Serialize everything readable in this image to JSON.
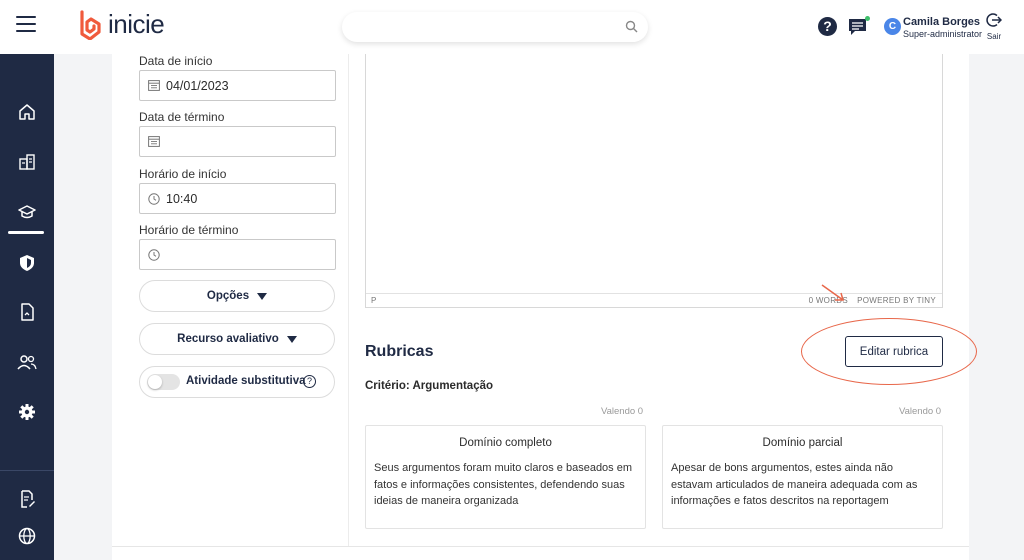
{
  "brand": {
    "name": "inicie",
    "color": "#f05a3c"
  },
  "header": {
    "search_placeholder": "",
    "user_initial": "C",
    "user_name": "Camila Borges",
    "user_role": "Super-administrator",
    "logout_label": "Sair"
  },
  "sidebar": {
    "items": [
      {
        "icon": "home-icon"
      },
      {
        "icon": "buildings-icon"
      },
      {
        "icon": "graduation-cap-icon",
        "active": true
      },
      {
        "icon": "shield-icon"
      },
      {
        "icon": "document-icon"
      },
      {
        "icon": "users-icon"
      },
      {
        "icon": "gear-icon"
      },
      {
        "icon": "document-edit-icon"
      },
      {
        "icon": "globe-icon"
      }
    ]
  },
  "form": {
    "start_date_label": "Data de início",
    "start_date_value": "04/01/2023",
    "end_date_label": "Data de término",
    "end_date_value": "",
    "start_time_label": "Horário de início",
    "start_time_value": "10:40",
    "end_time_label": "Horário de término",
    "end_time_value": "",
    "options_label": "Opções",
    "resource_label": "Recurso avaliativo",
    "substitute_label": "Atividade substitutiva",
    "substitute_on": false
  },
  "editor": {
    "path": "P",
    "word_count": "0 WORDS",
    "powered_by": "POWERED BY TINY"
  },
  "rubricas": {
    "title": "Rubricas",
    "edit_button": "Editar rubrica",
    "criterion": "Critério: Argumentação",
    "levels": [
      {
        "worth": "Valendo 0",
        "title": "Domínio completo",
        "description": "Seus argumentos foram muito claros e baseados em fatos e informações consistentes, defendendo suas ideias de maneira organizada"
      },
      {
        "worth": "Valendo 0",
        "title": "Domínio parcial",
        "description": "Apesar de bons argumentos, estes ainda não estavam articulados de maneira adequada com as informações e fatos descritos na reportagem"
      }
    ]
  },
  "colors": {
    "navy": "#1f2a44",
    "annotation": "#e8674a"
  }
}
